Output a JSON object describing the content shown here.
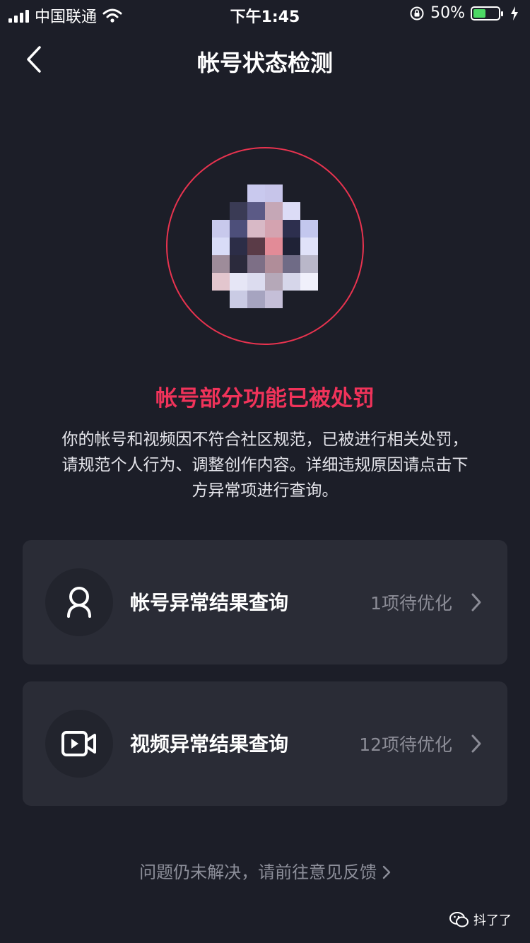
{
  "status_bar": {
    "carrier": "中国联通",
    "time": "下午1:45",
    "battery_percent": "50%",
    "battery_level": 0.5,
    "icons": [
      "signal-icon",
      "wifi-icon",
      "rotation-lock-icon",
      "battery-icon",
      "charging-icon"
    ]
  },
  "header": {
    "back_icon": "chevron-left-icon",
    "title": "帐号状态检测"
  },
  "avatar": {
    "ring_color": "#e8334f",
    "pixelated": true
  },
  "status": {
    "title": "帐号部分功能已被处罚",
    "title_color": "#f0335a",
    "description_lines": [
      "你的帐号和视频因不符合社区规范，已被进行相关处罚，",
      "请规范个人行为、调整创作内容。详细违规原因请点击下",
      "方异常项进行查询。"
    ]
  },
  "items": [
    {
      "icon": "user-icon",
      "label": "帐号异常结果查询",
      "count": "1项待优化",
      "chevron": "chevron-right-icon"
    },
    {
      "icon": "video-icon",
      "label": "视频异常结果查询",
      "count": "12项待优化",
      "chevron": "chevron-right-icon"
    }
  ],
  "feedback_link": "问题仍未解决，请前往意见反馈",
  "watermark": {
    "icon": "wechat-icon",
    "text": "抖了了"
  },
  "colors": {
    "background": "#1c1e28",
    "card": "#2a2c36",
    "accent": "#f0335a"
  }
}
